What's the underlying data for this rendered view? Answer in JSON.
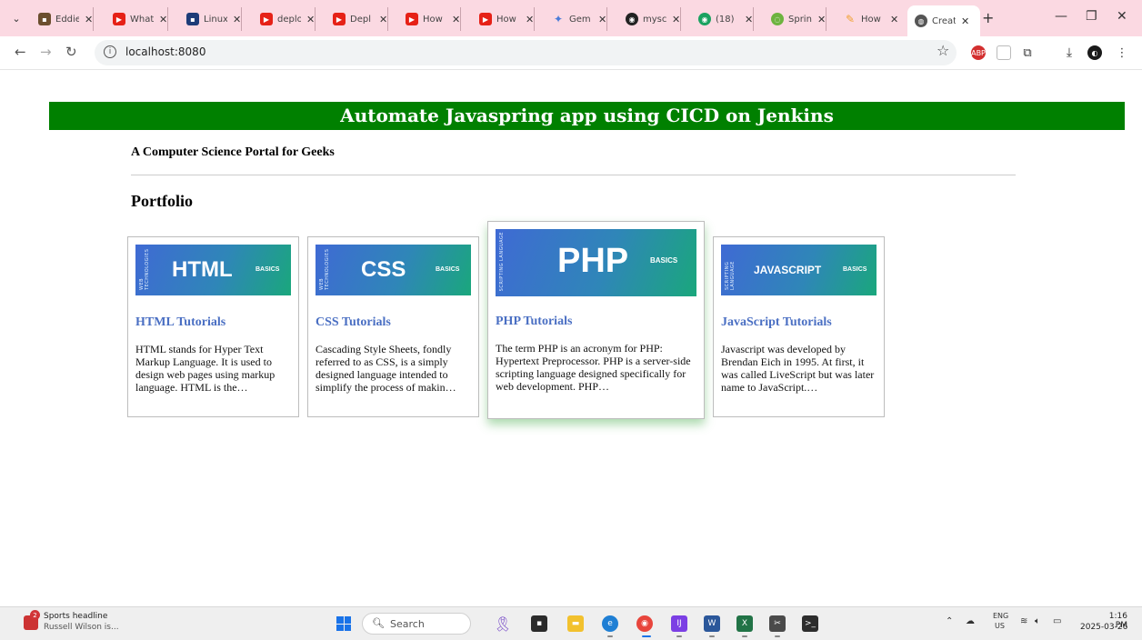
{
  "browser": {
    "tabs": [
      {
        "title": "Eddie",
        "fav_color": "#6b4e2e",
        "fav_glyph": "▪"
      },
      {
        "title": "What",
        "fav_color": "#e62117",
        "fav_glyph": "▶"
      },
      {
        "title": "Linux",
        "fav_color": "#1d3c78",
        "fav_glyph": "▪"
      },
      {
        "title": "deplo",
        "fav_color": "#e62117",
        "fav_glyph": "▶"
      },
      {
        "title": "Depl",
        "fav_color": "#e62117",
        "fav_glyph": "▶"
      },
      {
        "title": "How",
        "fav_color": "#e62117",
        "fav_glyph": "▶"
      },
      {
        "title": "How",
        "fav_color": "#e62117",
        "fav_glyph": "▶"
      },
      {
        "title": "Gem",
        "fav_color": "#4a7bd8",
        "fav_glyph": "✦"
      },
      {
        "title": "mysc",
        "fav_color": "#222222",
        "fav_glyph": "◉"
      },
      {
        "title": "(18)",
        "fav_color": "#1aa260",
        "fav_glyph": "◉"
      },
      {
        "title": "Sprin",
        "fav_color": "#6db33f",
        "fav_glyph": "◌"
      },
      {
        "title": "How",
        "fav_color": "#f0a030",
        "fav_glyph": "✎"
      },
      {
        "title": "Creat",
        "fav_color": "#555555",
        "fav_glyph": "◍"
      }
    ],
    "new_tab_label": "+",
    "url": "localhost:8080"
  },
  "page": {
    "banner": "Automate Javaspring app using CICD on Jenkins",
    "tagline": "A Computer Science Portal for Geeks",
    "section_title": "Portfolio",
    "cards": [
      {
        "thumb_label": "HTML",
        "side_label": "WEB TECHNOLOGIES",
        "basics": "BASICS",
        "title": "HTML Tutorials",
        "description": "HTML stands for Hyper Text Markup Language. It is used to design web pages using markup language. HTML is the…"
      },
      {
        "thumb_label": "CSS",
        "side_label": "WEB TECHNOLOGIES",
        "basics": "BASICS",
        "title": "CSS Tutorials",
        "description": "Cascading Style Sheets, fondly referred to as CSS, is a simply designed language intended to simplify the process of makin…"
      },
      {
        "thumb_label": "PHP",
        "side_label": "SCRIPTING LANGUAGE",
        "basics": "BASICS",
        "title": "PHP Tutorials",
        "description": "The term PHP is an acronym for PHP: Hypertext Preprocessor. PHP is a server-side scripting language designed specifically for web development. PHP…"
      },
      {
        "thumb_label": "JAVASCRIPT",
        "side_label": "SCRIPTING LANGUAGE",
        "basics": "BASICS",
        "title": "JavaScript Tutorials",
        "description": "Javascript was developed by Brendan Eich in 1995. At first, it was called LiveScript but was later name to JavaScript.…"
      }
    ],
    "colors": {
      "banner": "#008000",
      "card_title": "#4a6fc3",
      "featured_shadow": "#4caf50"
    }
  },
  "taskbar": {
    "news_badge": "2",
    "news_headline": "Sports headline",
    "news_sub": "Russell Wilson is...",
    "search_label": "Search",
    "lang_line1": "ENG",
    "lang_line2": "US",
    "time": "1:16 PM",
    "date": "2025-03-26"
  }
}
